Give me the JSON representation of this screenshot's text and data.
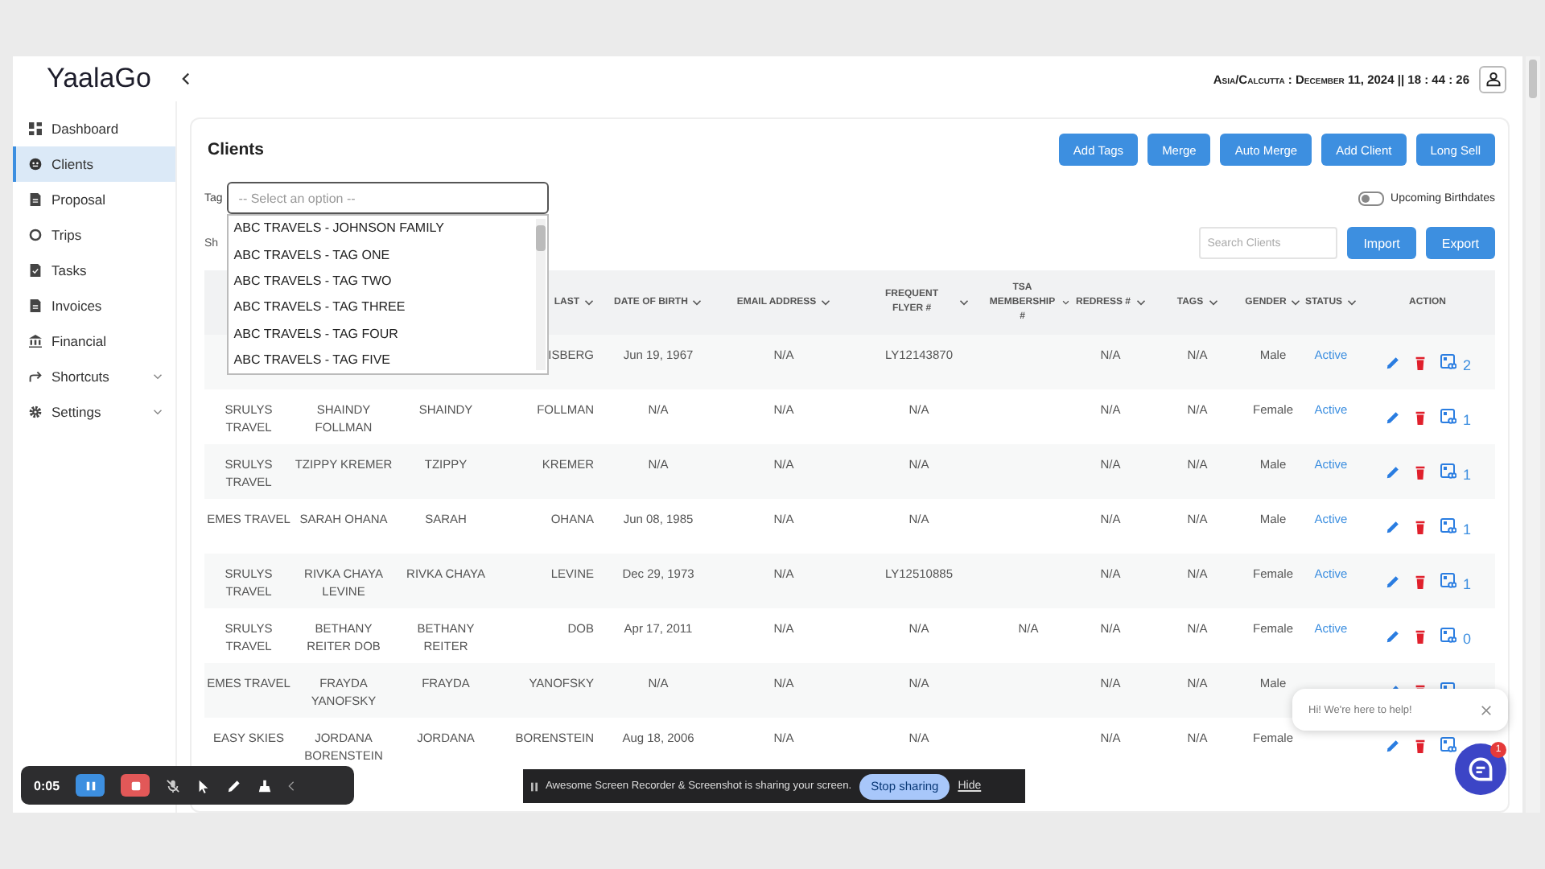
{
  "app": {
    "logo": "YaalaGo",
    "clock": "Asia/Calcutta : December 11, 2024 || 18 : 44 : 26"
  },
  "sidebar": {
    "items": [
      {
        "label": "Dashboard",
        "selected": false,
        "expandable": false
      },
      {
        "label": "Clients",
        "selected": true,
        "expandable": false
      },
      {
        "label": "Proposal",
        "selected": false,
        "expandable": false
      },
      {
        "label": "Trips",
        "selected": false,
        "expandable": false
      },
      {
        "label": "Tasks",
        "selected": false,
        "expandable": false
      },
      {
        "label": "Invoices",
        "selected": false,
        "expandable": false
      },
      {
        "label": "Financial",
        "selected": false,
        "expandable": false
      },
      {
        "label": "Shortcuts",
        "selected": false,
        "expandable": true
      },
      {
        "label": "Settings",
        "selected": false,
        "expandable": true
      }
    ]
  },
  "page": {
    "title": "Clients",
    "actions": [
      "Add Tags",
      "Merge",
      "Auto Merge",
      "Add Client",
      "Long Sell"
    ],
    "tag_filter": {
      "label": "Tag",
      "placeholder": "-- Select an option --",
      "expanded": true,
      "options": [
        "ABC TRAVELS - JOHNSON FAMILY",
        "ABC TRAVELS - TAG ONE",
        "ABC TRAVELS - TAG TWO",
        "ABC TRAVELS - TAG THREE",
        "ABC TRAVELS - TAG FOUR",
        "ABC TRAVELS - TAG FIVE"
      ]
    },
    "birthdays_toggle": {
      "label": "Upcoming Birthdates",
      "on": false
    },
    "show_label": "Sh",
    "search": {
      "placeholder": "Search Clients"
    },
    "table_buttons": [
      "Import",
      "Export"
    ]
  },
  "table": {
    "columns": [
      {
        "label": "LAST",
        "sortable": true
      },
      {
        "label": "DATE OF BIRTH",
        "sortable": true
      },
      {
        "label": "EMAIL ADDRESS",
        "sortable": true
      },
      {
        "label": "FREQUENT FLYER #",
        "sortable": true
      },
      {
        "label": "TSA MEMBERSHIP #",
        "sortable": true
      },
      {
        "label": "REDRESS #",
        "sortable": true
      },
      {
        "label": "TAGS",
        "sortable": true
      },
      {
        "label": "GENDER",
        "sortable": true
      },
      {
        "label": "STATUS",
        "sortable": true
      },
      {
        "label": "ACTION",
        "sortable": false
      }
    ],
    "rows": [
      {
        "last": "ISBERG",
        "dob": "Jun 19, 1967",
        "email": "N/A",
        "ff": "LY12143870",
        "redress": "N/A",
        "tags": "N/A",
        "gender": "Male",
        "status": "Active",
        "count": "2"
      },
      {
        "agency": "SRULYS TRAVEL",
        "name": "SHAINDY FOLLMAN",
        "first": "SHAINDY",
        "last": "FOLLMAN",
        "dob": "N/A",
        "email": "N/A",
        "ff": "N/A",
        "redress": "N/A",
        "tags": "N/A",
        "gender": "Female",
        "status": "Active",
        "count": "1"
      },
      {
        "agency": "SRULYS TRAVEL",
        "name": "TZIPPY KREMER",
        "first": "TZIPPY",
        "last": "KREMER",
        "dob": "N/A",
        "email": "N/A",
        "ff": "N/A",
        "redress": "N/A",
        "tags": "N/A",
        "gender": "Male",
        "status": "Active",
        "count": "1"
      },
      {
        "agency": "EMES TRAVEL",
        "name": "SARAH OHANA",
        "first": "SARAH",
        "last": "OHANA",
        "dob": "Jun 08, 1985",
        "email": "N/A",
        "ff": "N/A",
        "redress": "N/A",
        "tags": "N/A",
        "gender": "Male",
        "status": "Active",
        "count": "1"
      },
      {
        "agency": "SRULYS TRAVEL",
        "name": "RIVKA CHAYA LEVINE",
        "first": "RIVKA CHAYA",
        "last": "LEVINE",
        "dob": "Dec 29, 1973",
        "email": "N/A",
        "ff": "LY12510885",
        "redress": "N/A",
        "tags": "N/A",
        "gender": "Female",
        "status": "Active",
        "count": "1"
      },
      {
        "agency": "SRULYS TRAVEL",
        "name": "BETHANY REITER DOB",
        "first": "BETHANY REITER",
        "last": "DOB",
        "dob": "Apr 17, 2011",
        "email": "N/A",
        "ff": "N/A",
        "tsa": "N/A",
        "redress": "N/A",
        "tags": "N/A",
        "gender": "Female",
        "status": "Active",
        "count": "0"
      },
      {
        "agency": "EMES TRAVEL",
        "name": "FRAYDA YANOFSKY",
        "first": "FRAYDA",
        "last": "YANOFSKY",
        "dob": "N/A",
        "email": "N/A",
        "ff": "N/A",
        "redress": "N/A",
        "tags": "N/A",
        "gender": "Male"
      },
      {
        "agency": "EASY SKIES",
        "name": "JORDANA BORENSTEIN",
        "first": "JORDANA",
        "last": "BORENSTEIN",
        "dob": "Aug 18, 2006",
        "email": "N/A",
        "ff": "N/A",
        "redress": "N/A",
        "tags": "N/A",
        "gender": "Female"
      }
    ]
  },
  "chat": {
    "greeting": "Hi! We're here to help!",
    "badge": "1"
  },
  "recorder": {
    "time": "0:05"
  },
  "share_bar": {
    "message": "Awesome Screen Recorder & Screenshot is sharing your screen.",
    "stop": "Stop sharing",
    "hide": "Hide"
  }
}
